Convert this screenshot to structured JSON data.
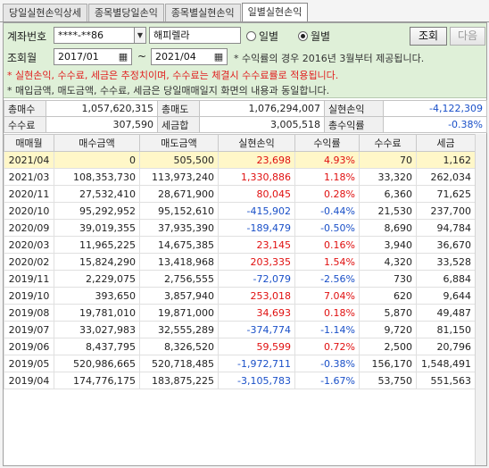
{
  "tabs": [
    {
      "label": "당일실현손익상세"
    },
    {
      "label": "종목별당일손익"
    },
    {
      "label": "종목별실현손익"
    },
    {
      "label": "일별실현손익"
    }
  ],
  "search": {
    "account_label": "계좌번호",
    "account_value": "****-**86",
    "account_name": "해피렐라",
    "period_label": "조회월",
    "from_month": "2017/01",
    "tilde": "~",
    "to_month": "2021/04",
    "radio_daily": "일별",
    "radio_monthly": "월별",
    "selected_radio": "월별",
    "query_button": "조회",
    "next_button": "다음",
    "note_range": "* 수익률의 경우 2016년 3월부터 제공됩니다.",
    "note_red": "* 실현손익, 수수료, 세금은 추정치이며, 수수료는 체결시 수수료률로 적용됩니다.",
    "note_dark": "* 매입금액, 매도금액, 수수료, 세금은 당일매매일지 화면의 내용과 동일합니다."
  },
  "summary": {
    "total_buy_label": "총매수",
    "total_buy": "1,057,620,315",
    "total_sell_label": "총매도",
    "total_sell": "1,076,294,007",
    "realized_label": "실현손익",
    "realized": "-4,122,309",
    "fee_label": "수수료",
    "fee": "307,590",
    "tax_label": "세금합",
    "tax": "3,005,518",
    "return_label": "총수익률",
    "return": "-0.38%"
  },
  "grid": {
    "columns": [
      "매매월",
      "매수금액",
      "매도금액",
      "실현손익",
      "수익률",
      "수수료",
      "세금"
    ],
    "rows": [
      [
        "2021/04",
        "0",
        "505,500",
        "23,698",
        "4.93%",
        "70",
        "1,162"
      ],
      [
        "2021/03",
        "108,353,730",
        "113,973,240",
        "1,330,886",
        "1.18%",
        "33,320",
        "262,034"
      ],
      [
        "2020/11",
        "27,532,410",
        "28,671,900",
        "80,045",
        "0.28%",
        "6,360",
        "71,625"
      ],
      [
        "2020/10",
        "95,292,952",
        "95,152,610",
        "-415,902",
        "-0.44%",
        "21,530",
        "237,700"
      ],
      [
        "2020/09",
        "39,019,355",
        "37,935,390",
        "-189,479",
        "-0.50%",
        "8,690",
        "94,784"
      ],
      [
        "2020/03",
        "11,965,225",
        "14,675,385",
        "23,145",
        "0.16%",
        "3,940",
        "36,670"
      ],
      [
        "2020/02",
        "15,824,290",
        "13,418,968",
        "203,335",
        "1.54%",
        "4,320",
        "33,528"
      ],
      [
        "2019/11",
        "2,229,075",
        "2,756,555",
        "-72,079",
        "-2.56%",
        "730",
        "6,884"
      ],
      [
        "2019/10",
        "393,650",
        "3,857,940",
        "253,018",
        "7.04%",
        "620",
        "9,644"
      ],
      [
        "2019/08",
        "19,781,010",
        "19,871,000",
        "34,693",
        "0.18%",
        "5,870",
        "49,487"
      ],
      [
        "2019/07",
        "33,027,983",
        "32,555,289",
        "-374,774",
        "-1.14%",
        "9,720",
        "81,150"
      ],
      [
        "2019/06",
        "8,437,795",
        "8,326,520",
        "59,599",
        "0.72%",
        "2,500",
        "20,796"
      ],
      [
        "2019/05",
        "520,986,665",
        "520,718,485",
        "-1,972,711",
        "-0.38%",
        "156,170",
        "1,548,491"
      ],
      [
        "2019/04",
        "174,776,175",
        "183,875,225",
        "-3,105,783",
        "-1.67%",
        "53,750",
        "551,563"
      ]
    ]
  },
  "colors": {
    "search_bg": "#dff0d8",
    "positive": "#e01010",
    "negative": "#1a50c8",
    "selected_row": "#fff7c8"
  },
  "icons": {
    "dropdown": "chevron-down-icon",
    "calendar": "calendar-icon"
  }
}
